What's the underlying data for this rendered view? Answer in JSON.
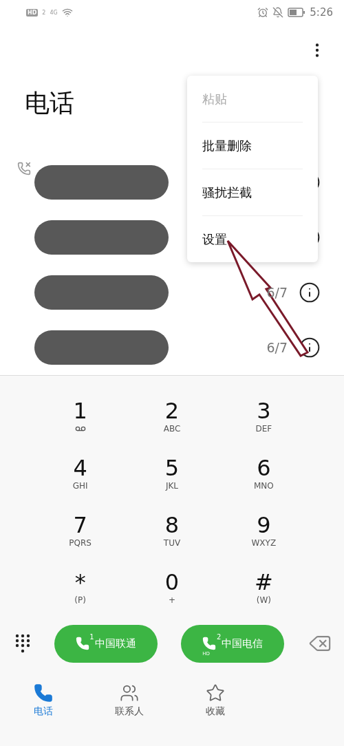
{
  "status_bar": {
    "hd": "HD",
    "sim_slot": "2",
    "network": "4G",
    "time": "5:26"
  },
  "header": {
    "title": "电话"
  },
  "calls": [
    {
      "missed": true,
      "redacted": true
    },
    {
      "missed": false,
      "redacted": true
    },
    {
      "missed": false,
      "date": "6/7",
      "redacted": true
    },
    {
      "missed": false,
      "date": "6/7",
      "redacted": true
    }
  ],
  "menu": {
    "items": [
      {
        "label": "粘贴",
        "disabled": true
      },
      {
        "label": "批量删除",
        "disabled": false
      },
      {
        "label": "骚扰拦截",
        "disabled": false
      },
      {
        "label": "设置",
        "disabled": false
      }
    ]
  },
  "keypad": [
    {
      "digit": "1",
      "kind": "voicemail"
    },
    {
      "digit": "2",
      "kind": "letters",
      "sub": "ABC"
    },
    {
      "digit": "3",
      "kind": "letters",
      "sub": "DEF"
    },
    {
      "digit": "4",
      "kind": "letters",
      "sub": "GHI"
    },
    {
      "digit": "5",
      "kind": "letters",
      "sub": "JKL"
    },
    {
      "digit": "6",
      "kind": "letters",
      "sub": "MNO"
    },
    {
      "digit": "7",
      "kind": "letters",
      "sub": "PQRS"
    },
    {
      "digit": "8",
      "kind": "letters",
      "sub": "TUV"
    },
    {
      "digit": "9",
      "kind": "letters",
      "sub": "WXYZ"
    },
    {
      "digit": "*",
      "kind": "letters",
      "sub": "(P)"
    },
    {
      "digit": "0",
      "kind": "letters",
      "sub": "+"
    },
    {
      "digit": "#",
      "kind": "letters",
      "sub": "(W)"
    }
  ],
  "call_buttons": [
    {
      "label": "中国联通",
      "sim": "1"
    },
    {
      "label": "中国电信",
      "sim": "2",
      "hd": "HD"
    }
  ],
  "tabs": [
    {
      "label": "电话",
      "selected": true,
      "kind": "phone"
    },
    {
      "label": "联系人",
      "selected": false,
      "kind": "contacts"
    },
    {
      "label": "收藏",
      "selected": false,
      "kind": "favorites"
    }
  ]
}
